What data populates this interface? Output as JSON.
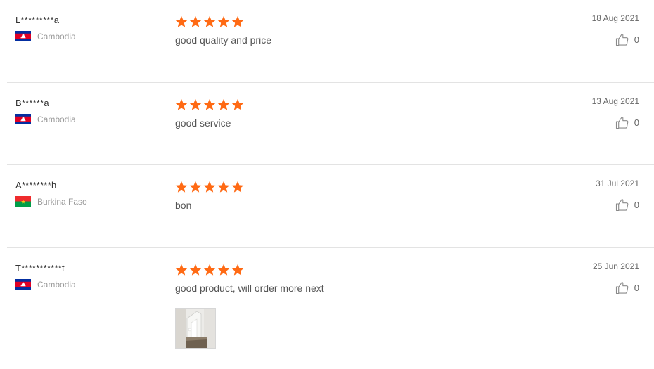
{
  "colors": {
    "star": "#ff6a14",
    "divider": "#e3e3e3",
    "muted_text": "#999999"
  },
  "reviews": [
    {
      "user": "L*********a",
      "country": "Cambodia",
      "flag_icon": "cambodia-flag-icon",
      "rating": 5,
      "comment": "good quality and price",
      "date": "18 Aug 2021",
      "likes": "0"
    },
    {
      "user": "B******a",
      "country": "Cambodia",
      "flag_icon": "cambodia-flag-icon",
      "rating": 5,
      "comment": "good service",
      "date": "13 Aug 2021",
      "likes": "0"
    },
    {
      "user": "A********h",
      "country": "Burkina Faso",
      "flag_icon": "burkina-faso-flag-icon",
      "rating": 5,
      "comment": "bon",
      "date": "31 Jul 2021",
      "likes": "0"
    },
    {
      "user": "T***********t",
      "country": "Cambodia",
      "flag_icon": "cambodia-flag-icon",
      "rating": 5,
      "comment": "good product, will order more next",
      "date": "25 Jun 2021",
      "likes": "0",
      "photo_icon": "review-photo-thumbnail"
    }
  ]
}
